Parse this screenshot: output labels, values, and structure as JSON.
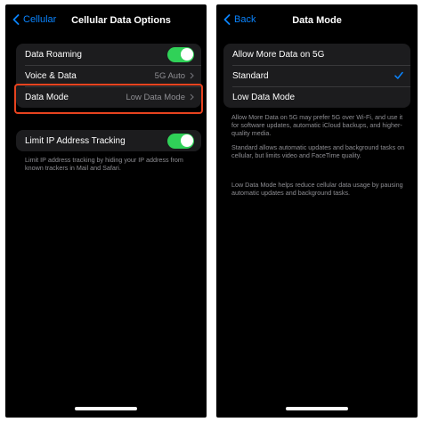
{
  "left": {
    "back_label": "Cellular",
    "title": "Cellular Data Options",
    "rows": [
      {
        "label": "Data Roaming",
        "type": "toggle",
        "on": true
      },
      {
        "label": "Voice & Data",
        "value": "5G Auto",
        "type": "link"
      },
      {
        "label": "Data Mode",
        "value": "Low Data Mode",
        "type": "link"
      }
    ],
    "limit_ip": {
      "label": "Limit IP Address Tracking",
      "on": true
    },
    "footnote": "Limit IP address tracking by hiding your IP address from known trackers in Mail and Safari."
  },
  "right": {
    "back_label": "Back",
    "title": "Data Mode",
    "options": [
      {
        "label": "Allow More Data on 5G",
        "selected": false
      },
      {
        "label": "Standard",
        "selected": true
      },
      {
        "label": "Low Data Mode",
        "selected": false
      }
    ],
    "desc1": "Allow More Data on 5G may prefer 5G over Wi-Fi, and use it for software updates, automatic iCloud backups, and higher-quality media.",
    "desc2": "Standard allows automatic updates and background tasks on cellular, but limits video and FaceTime quality.",
    "desc3": "Low Data Mode helps reduce cellular data usage by pausing automatic updates and background tasks."
  },
  "colors": {
    "accent": "#0a84ff",
    "toggle_on": "#30d158",
    "highlight": "#e8431f"
  }
}
